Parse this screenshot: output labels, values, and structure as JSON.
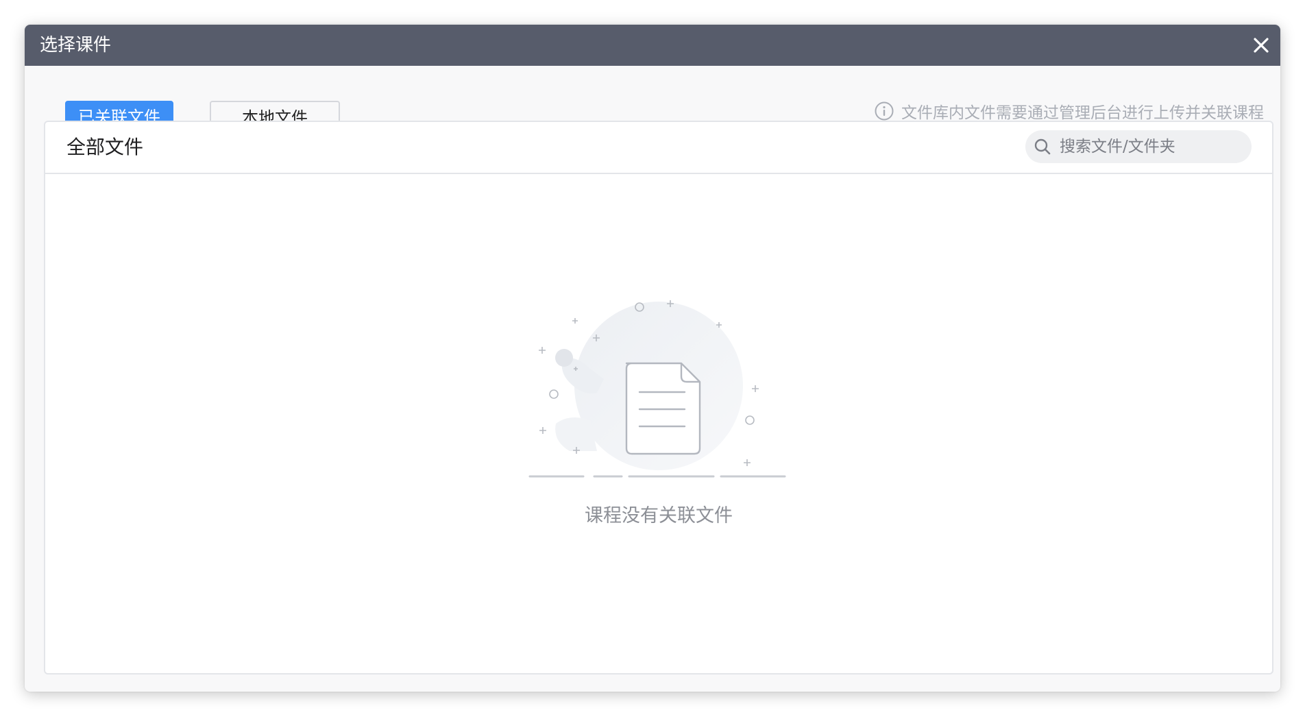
{
  "window": {
    "title": "选择课件",
    "close_icon": "close-icon"
  },
  "tabs": [
    {
      "label": "已关联文件",
      "active": true
    },
    {
      "label": "本地文件",
      "active": false
    }
  ],
  "hint": {
    "icon": "info-icon",
    "text": "文件库内文件需要通过管理后台进行上传并关联课程"
  },
  "panel": {
    "title": "全部文件",
    "search": {
      "icon": "search-icon",
      "placeholder": "搜索文件/文件夹",
      "value": ""
    },
    "empty_state": {
      "icon": "empty-document-icon",
      "message": "课程没有关联文件"
    }
  },
  "colors": {
    "titlebar": "#575c6b",
    "active_tab": "#3d8ff6",
    "hint_text": "#a9adb5",
    "empty_text": "#8c8f96"
  }
}
